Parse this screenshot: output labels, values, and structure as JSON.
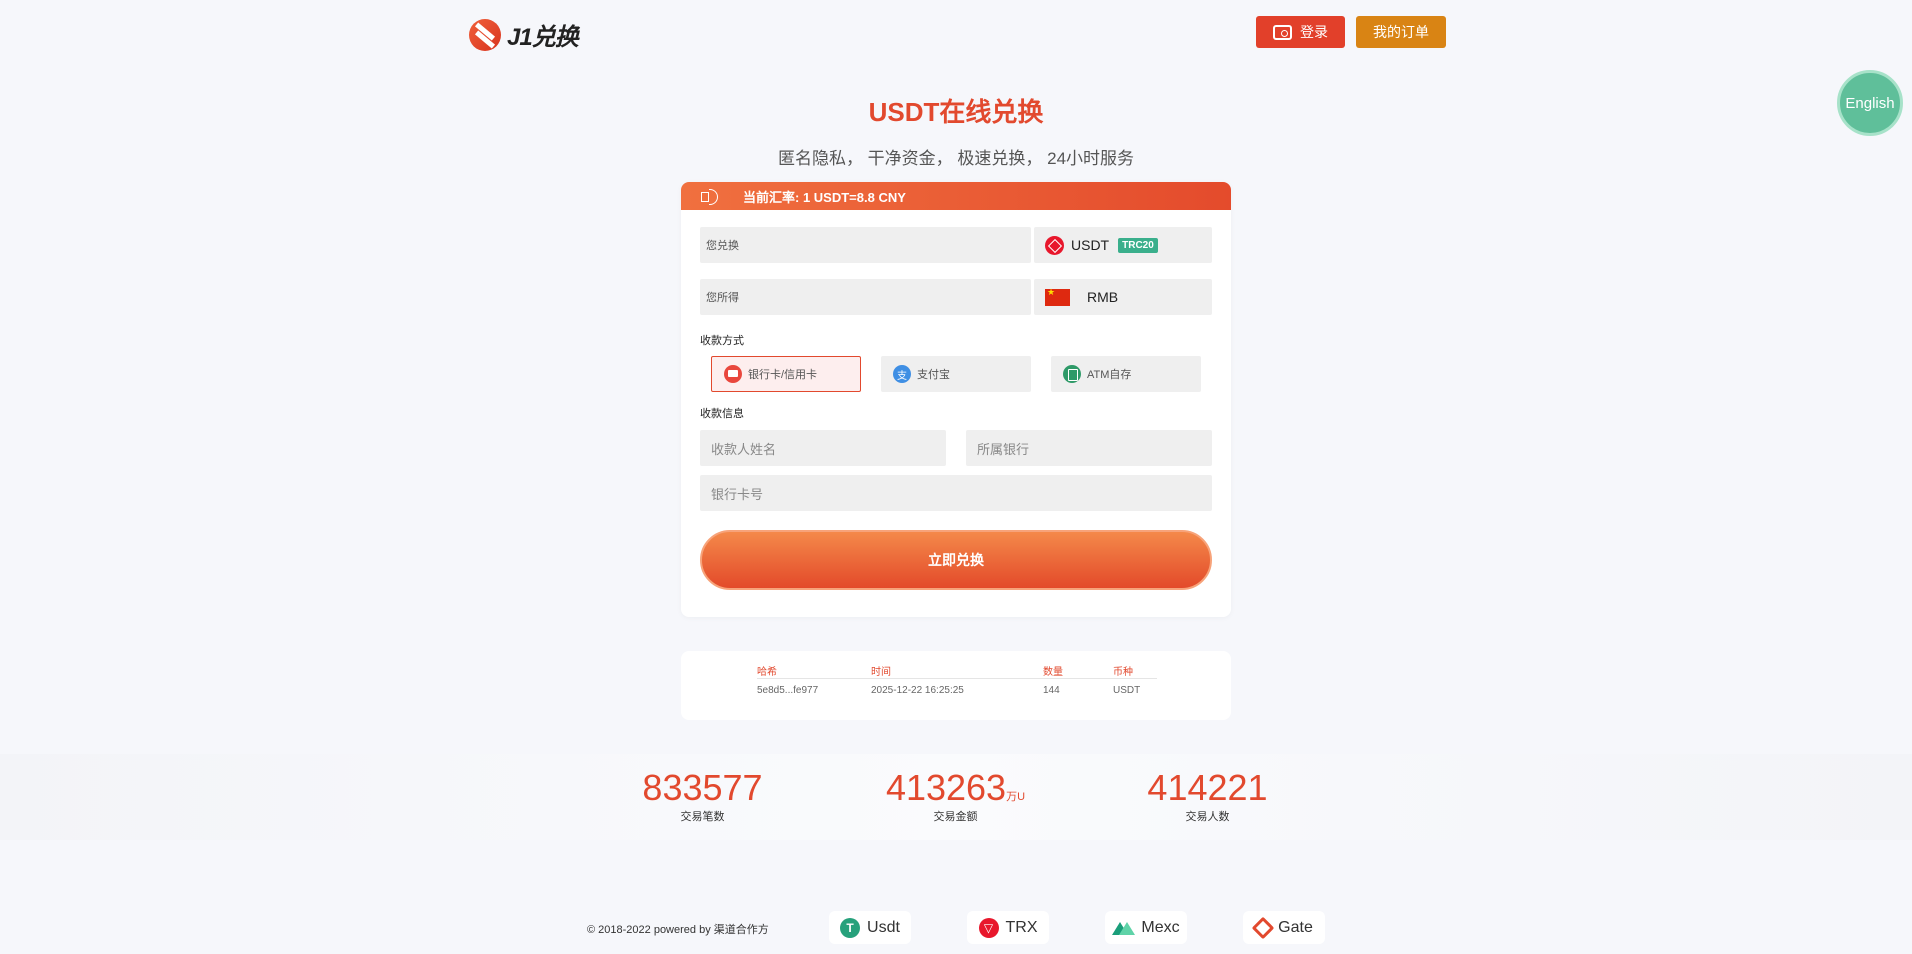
{
  "header": {
    "logo_text": "J1兑换",
    "login_label": "登录",
    "orders_label": "我的订单",
    "language_label": "English"
  },
  "hero": {
    "title": "USDT在线兑换",
    "subtitle": "匿名隐私， 干净资金， 极速兑换， 24小时服务"
  },
  "exchange": {
    "rate_text": "当前汇率: 1 USDT=8.8 CNY",
    "send_placeholder": "您兑换",
    "send_currency": "USDT",
    "send_network": "TRC20",
    "receive_placeholder": "您所得",
    "receive_currency": "RMB",
    "payment_method_label": "收款方式",
    "payment_methods": [
      {
        "label": "银行卡/信用卡",
        "icon": "bank-card-icon",
        "selected": true
      },
      {
        "label": "支付宝",
        "icon": "alipay-icon",
        "selected": false
      },
      {
        "label": "ATM自存",
        "icon": "atm-icon",
        "selected": false
      }
    ],
    "payee_info_label": "收款信息",
    "payee_name_placeholder": "收款人姓名",
    "bank_placeholder": "所属银行",
    "card_number_placeholder": "银行卡号",
    "submit_label": "立即兑换"
  },
  "transactions": {
    "headers": [
      "哈希",
      "时间",
      "数量",
      "币种"
    ],
    "rows": [
      {
        "hash": "5e8d5...fe977",
        "time": "2025-12-22 16:25:25",
        "amount": "144",
        "coin": "USDT"
      }
    ]
  },
  "stats": [
    {
      "value": "833577",
      "unit": "",
      "label": "交易笔数"
    },
    {
      "value": "413263",
      "unit": "万U",
      "label": "交易金额"
    },
    {
      "value": "414221",
      "unit": "",
      "label": "交易人数"
    }
  ],
  "footer": {
    "copyright": "© 2018-2022 powered by 渠道合作方",
    "partners": [
      {
        "name": "Usdt",
        "icon": "usdt-icon"
      },
      {
        "name": "TRX",
        "icon": "trx-icon"
      },
      {
        "name": "Mexc",
        "icon": "mexc-icon"
      },
      {
        "name": "Gate",
        "icon": "gate-icon"
      }
    ]
  },
  "colors": {
    "primary": "#e2492e",
    "orders_button": "#d98414",
    "language_button": "#5fbf9a",
    "network_badge": "#3aaf8c"
  }
}
